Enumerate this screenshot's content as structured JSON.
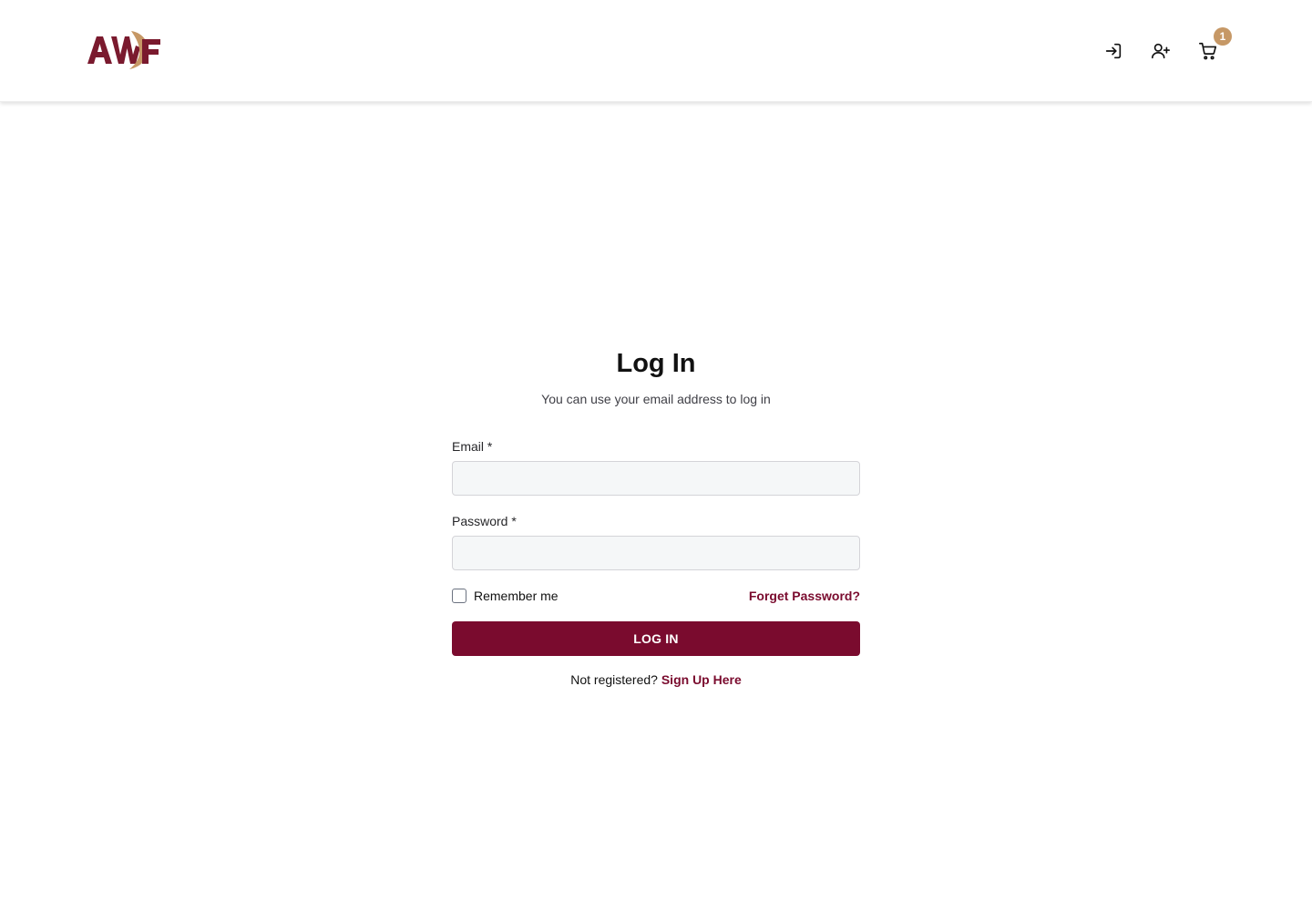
{
  "header": {
    "logo_text": "AWF",
    "icons": {
      "login": "login-icon",
      "register": "user-plus-icon",
      "cart": "shopping-cart-icon"
    },
    "cart_count": "1"
  },
  "colors": {
    "brand": "#7a0b2e",
    "accent": "#c69866"
  },
  "login": {
    "title": "Log In",
    "subtitle": "You can use your email address to log in",
    "email_label": "Email *",
    "email_value": "",
    "password_label": "Password *",
    "password_value": "",
    "remember_label": "Remember me",
    "forgot_label": "Forget Password?",
    "submit_label": "LOG IN",
    "not_registered": "Not registered?",
    "signup_label": "Sign Up Here"
  }
}
